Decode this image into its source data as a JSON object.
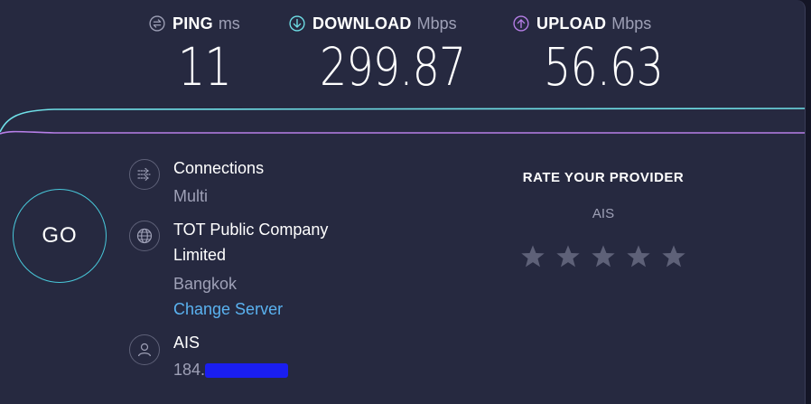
{
  "metrics": {
    "ping": {
      "label": "PING",
      "unit": "ms",
      "value": "11"
    },
    "download": {
      "label": "DOWNLOAD",
      "unit": "Mbps",
      "value": "299.87"
    },
    "upload": {
      "label": "UPLOAD",
      "unit": "Mbps",
      "value": "56.63"
    }
  },
  "go_button": {
    "label": "GO"
  },
  "connections": {
    "title": "Connections",
    "value": "Multi"
  },
  "server": {
    "name_line1": "TOT Public Company",
    "name_line2": "Limited",
    "location": "Bangkok",
    "change_label": "Change Server"
  },
  "client": {
    "isp": "AIS",
    "ip_prefix": "184."
  },
  "rating": {
    "title": "RATE YOUR PROVIDER",
    "provider": "AIS",
    "stars": 5,
    "selected": 0
  },
  "colors": {
    "background": "#262940",
    "ping_icon": "#9ea0b6",
    "download_accent": "#6fe0e8",
    "upload_accent": "#b77fe8",
    "link": "#5ab2f0",
    "star": "#5e6178"
  },
  "icons": {
    "ping": "ping-arrows-icon",
    "download": "download-arrow-icon",
    "upload": "upload-arrow-icon",
    "connections": "multi-connection-icon",
    "server": "globe-icon",
    "client": "user-icon"
  }
}
